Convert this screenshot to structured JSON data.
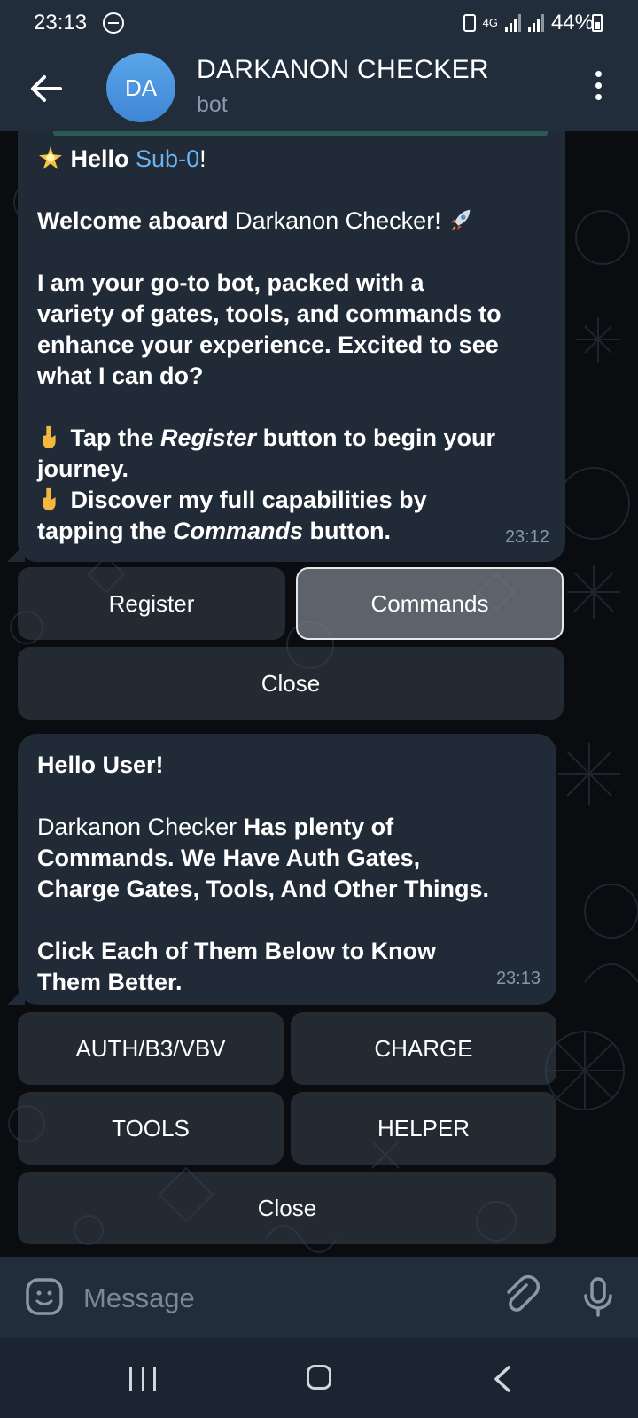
{
  "status_bar": {
    "time": "23:13",
    "network": "4G",
    "battery": "44%"
  },
  "header": {
    "avatar_initials": "DA",
    "title": "DARKANON CHECKER",
    "subtitle": "bot"
  },
  "messages": [
    {
      "greeting_prefix": "Hello ",
      "username": "Sub-0",
      "greeting_suffix": "!",
      "welcome_bold": "Welcome aboard",
      "welcome_rest": " Darkanon Checker!",
      "intro_lines": [
        "I am your go-to bot, packed with a",
        "variety of gates, tools, and commands to",
        "enhance your experience. Excited to see",
        "what I can do?"
      ],
      "tap_prefix": "Tap the ",
      "tap_italic": "Register",
      "tap_suffix": " button to begin your",
      "tap_line2": "journey.",
      "discover_line1": "Discover my full capabilities by",
      "discover_prefix": "tapping the ",
      "discover_italic": "Commands",
      "discover_suffix": " button.",
      "time": "23:12"
    },
    {
      "hello": "Hello User!",
      "line1_normal": "Darkanon Checker ",
      "line1_bold": "Has plenty of",
      "line2": "Commands. We Have Auth Gates,",
      "line3": "Charge Gates, Tools, And Other Things.",
      "line4": "Click Each of Them Below to Know",
      "line5": "Them Better.",
      "time": "23:13"
    }
  ],
  "keyboard1": {
    "register": "Register",
    "commands": "Commands",
    "close": "Close"
  },
  "keyboard2": {
    "auth": "AUTH/B3/VBV",
    "charge": "CHARGE",
    "tools": "TOOLS",
    "helper": "HELPER",
    "close": "Close"
  },
  "input": {
    "placeholder": "Message"
  },
  "icons": {
    "back": "arrow-left-icon",
    "more": "more-vertical-icon",
    "emoji": "sticker-icon",
    "attach": "paperclip-icon",
    "mic": "microphone-icon"
  }
}
